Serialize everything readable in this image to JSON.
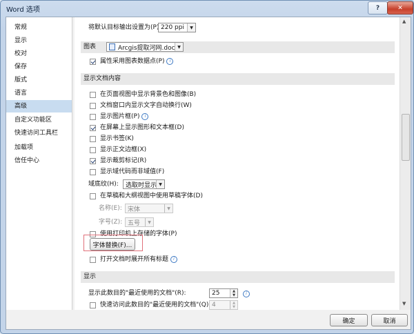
{
  "window": {
    "title": "Word 选项",
    "help": "?",
    "close": "✕"
  },
  "nav": [
    "常规",
    "显示",
    "校对",
    "保存",
    "版式",
    "语言",
    "高级",
    "自定义功能区",
    "快速访问工具栏",
    "加载项",
    "信任中心"
  ],
  "top": {
    "resolution_label": "将默认目标输出设置为(P):",
    "resolution_value": "220 ppi"
  },
  "chart_section": {
    "header": "图表",
    "doc_value": "Arcgis提取河网.docx",
    "option": "属性采用图表数据点(P)"
  },
  "doc_content": {
    "header": "显示文档内容",
    "options": [
      {
        "label": "在页面视图中显示背景色和图像(B)",
        "checked": false
      },
      {
        "label": "文档窗口内显示文字自动换行(W)",
        "checked": false
      },
      {
        "label": "显示图片框(P)",
        "checked": false,
        "info": true
      },
      {
        "label": "在屏幕上显示图形和文本框(D)",
        "checked": true
      },
      {
        "label": "显示书签(K)",
        "checked": false
      },
      {
        "label": "显示正文边框(X)",
        "checked": false
      },
      {
        "label": "显示裁剪标记(R)",
        "checked": true
      },
      {
        "label": "显示域代码而非域值(F)",
        "checked": false
      }
    ],
    "shading_label": "域底纹(H):",
    "shading_value": "选取时显示",
    "draft_font_option": "在草稿和大纲视图中使用草稿字体(D)",
    "name_label": "名称(E):",
    "name_value": "宋体",
    "size_label": "字号(Z):",
    "size_value": "五号",
    "printer_fonts_option": "使用打印机上存储的字体(P)",
    "font_sub_button": "字体替换(F)...",
    "expand_headings_option": "打开文档时展开所有标题"
  },
  "display": {
    "header": "显示",
    "recent_docs_label": "显示此数目的\"最近使用的文档\"(R):",
    "recent_docs_value": "25",
    "quick_access_label": "快速访问此数目的\"最近使用的文档\"(Q):",
    "quick_access_value": "4"
  },
  "footer": {
    "ok": "确定",
    "cancel": "取消"
  }
}
